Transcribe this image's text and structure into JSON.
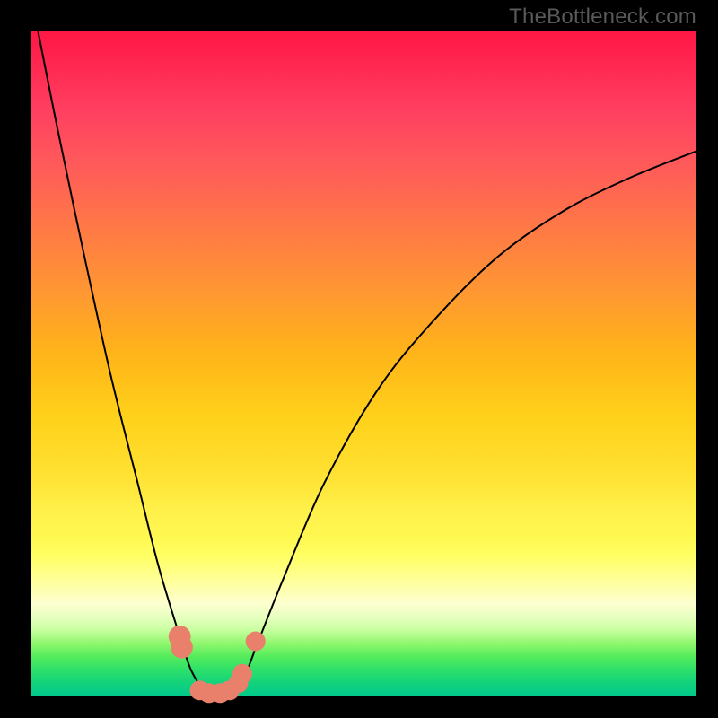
{
  "watermark": "TheBottleneck.com",
  "colors": {
    "frame": "#000000",
    "curve": "#000000",
    "marker": "#e9806b"
  },
  "chart_data": {
    "type": "line",
    "title": "",
    "xlabel": "",
    "ylabel": "",
    "xlim": [
      0,
      100
    ],
    "ylim": [
      0,
      100
    ],
    "grid": false,
    "legend": null,
    "note": "No axes or tick labels are visible; x and y values are estimated on a 0–100 scale where y = bottleneck percentage (0 at green bottom, 100 at red top). Minimum bottleneck ≈ x 26–30.",
    "background_gradient_stops": [
      {
        "pos": 0,
        "color": "#ff1744"
      },
      {
        "pos": 20,
        "color": "#ff5a5a"
      },
      {
        "pos": 40,
        "color": "#ff9a30"
      },
      {
        "pos": 60,
        "color": "#ffd11a"
      },
      {
        "pos": 80,
        "color": "#ffff66"
      },
      {
        "pos": 90,
        "color": "#c8ffa0"
      },
      {
        "pos": 100,
        "color": "#00c98b"
      }
    ],
    "series": [
      {
        "name": "bottleneck-curve",
        "x": [
          1,
          4,
          8,
          12,
          16,
          19,
          22,
          24,
          26,
          28,
          30,
          32,
          34,
          38,
          44,
          52,
          60,
          70,
          80,
          90,
          100
        ],
        "y": [
          100,
          85,
          66,
          48,
          32,
          20,
          10,
          4,
          1,
          0,
          1,
          3,
          8,
          18,
          32,
          46,
          56,
          66,
          73,
          78,
          82
        ]
      }
    ],
    "markers": {
      "name": "highlight-points",
      "points": [
        {
          "x": 22.3,
          "y": 9.0,
          "r": 1.2
        },
        {
          "x": 22.6,
          "y": 7.4,
          "r": 1.2
        },
        {
          "x": 25.3,
          "y": 0.9,
          "r": 1.0
        },
        {
          "x": 26.7,
          "y": 0.5,
          "r": 1.0
        },
        {
          "x": 28.4,
          "y": 0.5,
          "r": 1.0
        },
        {
          "x": 29.8,
          "y": 0.9,
          "r": 1.0
        },
        {
          "x": 31.1,
          "y": 2.0,
          "r": 1.0
        },
        {
          "x": 31.7,
          "y": 3.4,
          "r": 1.0
        },
        {
          "x": 33.7,
          "y": 8.3,
          "r": 1.0
        }
      ]
    }
  }
}
